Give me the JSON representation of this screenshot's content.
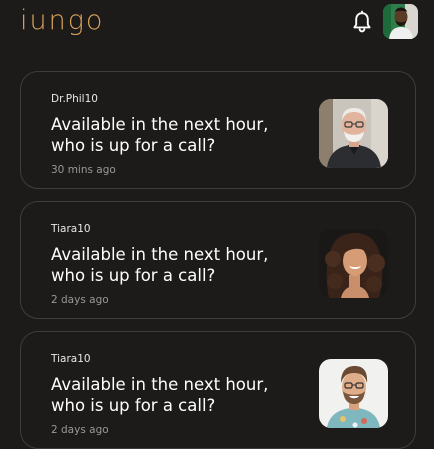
{
  "app": {
    "logo_text": "iungo",
    "brand_color": "#d8a25a",
    "bell_icon": "bell-icon"
  },
  "notifications": [
    {
      "user": "Dr.Phil10",
      "message": "Available in the next hour, who is up for a call?",
      "time": "30 mins ago"
    },
    {
      "user": "Tiara10",
      "message": "Available in the next hour, who is up for a call?",
      "time": "2 days ago"
    },
    {
      "user": "Tiara10",
      "message": "Available in the next hour, who is up for a call?",
      "time": "2 days ago"
    }
  ]
}
